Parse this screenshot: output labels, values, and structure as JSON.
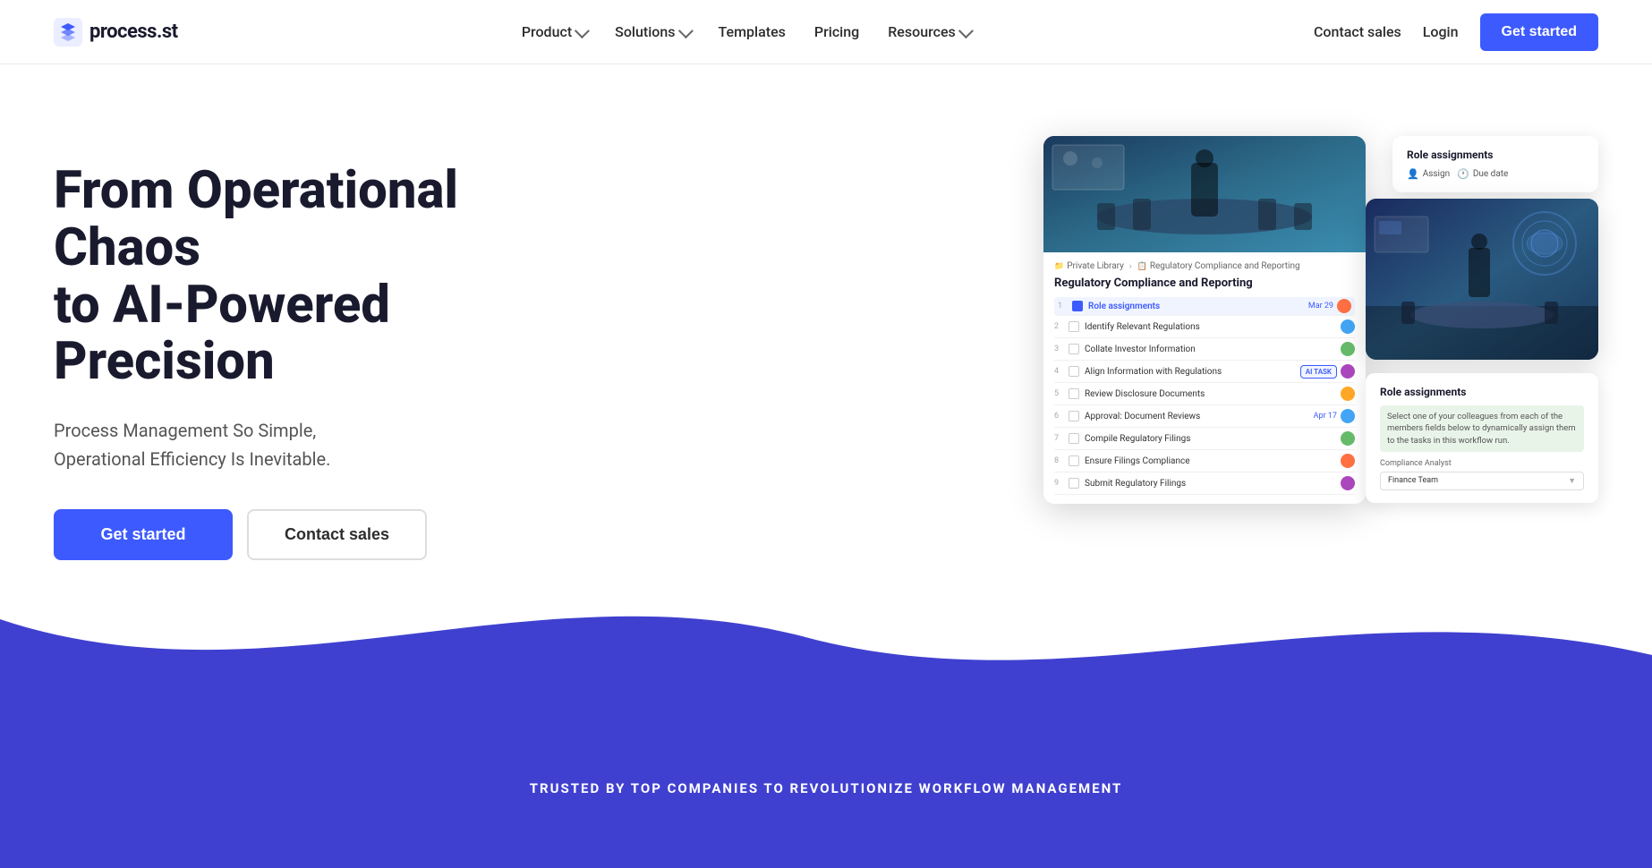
{
  "nav": {
    "logo_text": "process.st",
    "links": [
      {
        "label": "Product",
        "has_dropdown": true
      },
      {
        "label": "Solutions",
        "has_dropdown": true
      },
      {
        "label": "Templates",
        "has_dropdown": false
      },
      {
        "label": "Pricing",
        "has_dropdown": false
      },
      {
        "label": "Resources",
        "has_dropdown": true
      }
    ],
    "contact_sales": "Contact sales",
    "login": "Login",
    "get_started": "Get started"
  },
  "hero": {
    "title_line1": "From Operational Chaos",
    "title_line2": "to AI-Powered Precision",
    "subtitle_line1": "Process Management So Simple,",
    "subtitle_line2": "Operational Efficiency Is Inevitable.",
    "btn_primary": "Get started",
    "btn_secondary": "Contact sales"
  },
  "workflow": {
    "breadcrumb_lib": "Private Library",
    "breadcrumb_folder": "Regulatory Compliance and Reporting",
    "title": "Regulatory Compliance and Reporting",
    "tasks": [
      {
        "num": "1",
        "name": "Role assignments",
        "date": "Mar 29",
        "avatar": "a",
        "active": true
      },
      {
        "num": "2",
        "name": "Identify Relevant Regulations",
        "date": "",
        "avatar": "b",
        "active": false
      },
      {
        "num": "3",
        "name": "Collate Investor Information",
        "date": "",
        "avatar": "c",
        "active": false
      },
      {
        "num": "4",
        "name": "Align Information with Regulations",
        "date": "",
        "avatar": "d",
        "ai": true,
        "active": false
      },
      {
        "num": "5",
        "name": "Review Disclosure Documents",
        "date": "",
        "avatar": "e",
        "active": false
      },
      {
        "num": "6",
        "name": "Approval: Document Reviews",
        "date": "Apr 17",
        "avatar": "b",
        "active": false
      },
      {
        "num": "7",
        "name": "Compile Regulatory Filings",
        "date": "",
        "avatar": "c",
        "active": false
      },
      {
        "num": "8",
        "name": "Ensure Filings Compliance",
        "date": "",
        "avatar": "a",
        "active": false
      },
      {
        "num": "9",
        "name": "Submit Regulatory Filings",
        "date": "",
        "avatar": "d",
        "active": false
      }
    ]
  },
  "role_top": {
    "title": "Role assignments",
    "assign_label": "Assign",
    "due_label": "Due date"
  },
  "role_bottom": {
    "title": "Role assignments",
    "description": "Select one of your colleagues from each of the members fields below to dynamically assign them to the tasks in this workflow run.",
    "field_label": "Compliance Analyst",
    "select_value": "Finance Team"
  },
  "footer_trust": {
    "text": "TRUSTED BY TOP COMPANIES TO REVOLUTIONIZE WORKFLOW MANAGEMENT"
  }
}
